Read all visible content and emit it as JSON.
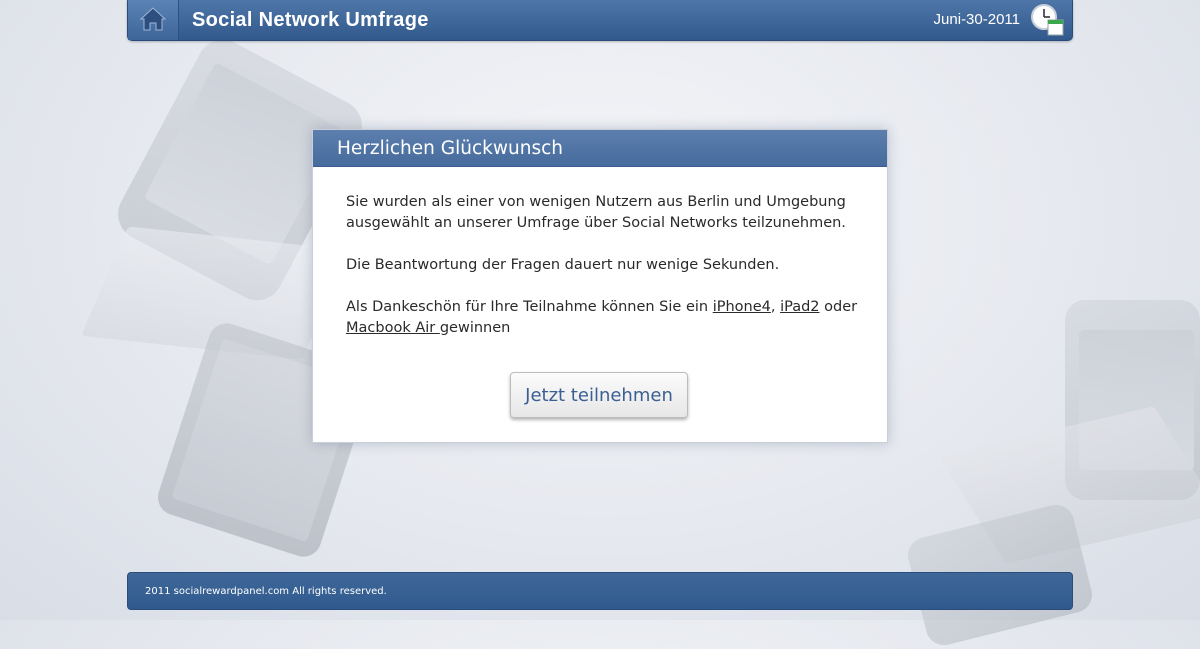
{
  "header": {
    "title": "Social Network Umfrage",
    "date": "Juni-30-2011",
    "home_icon": "home-icon",
    "clock_icon": "clock-calendar-icon"
  },
  "dialog": {
    "title": "Herzlichen Glückwunsch",
    "paragraph1": "Sie wurden als einer von wenigen Nutzern aus Berlin und Umgebung ausgewählt an unserer Umfrage über Social Networks teilzunehmen.",
    "paragraph2": "Die Beantwortung der Fragen dauert nur wenige Sekunden.",
    "paragraph3_prefix": "Als Dankeschön für Ihre Teilnahme können Sie ein ",
    "prize1": "iPhone4",
    "separator": ", ",
    "prize2": "iPad2",
    "conjunction": " oder ",
    "prize3": "Macbook Air ",
    "paragraph3_suffix": "gewinnen",
    "button_label": "Jetzt teilnehmen"
  },
  "footer": {
    "copyright": "2011 socialrewardpanel.com All rights reserved."
  },
  "colors": {
    "header_blue": "#3a6196",
    "dialog_title_blue": "#4f74a5",
    "button_text": "#3b5f93"
  }
}
